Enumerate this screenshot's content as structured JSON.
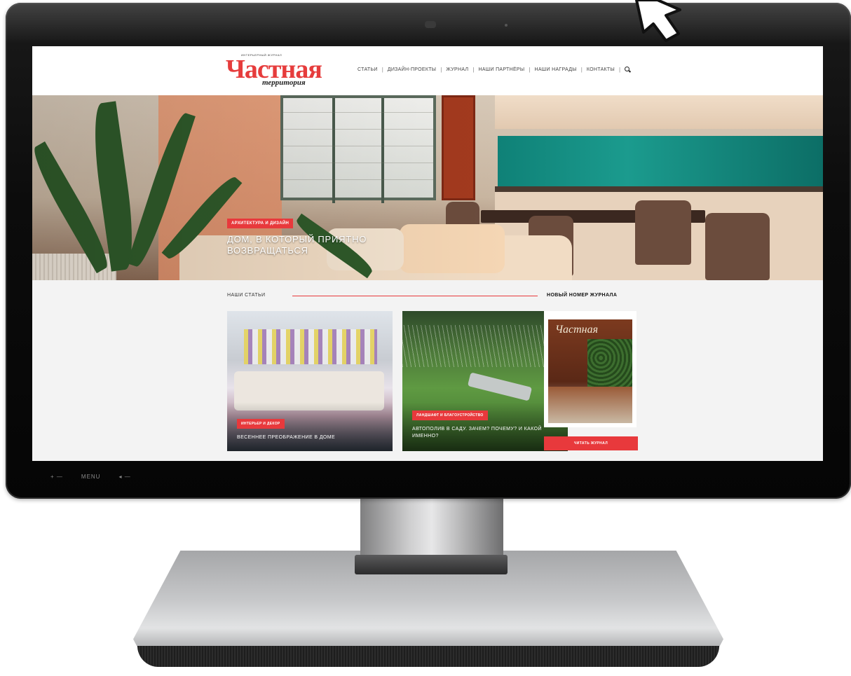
{
  "site": {
    "logo_tagline": "ИНТЕРЬЕРНЫЙ ЖУРНАЛ",
    "logo_main": "Частная",
    "logo_sub": "территория"
  },
  "nav": {
    "items": [
      "СТАТЬИ",
      "ДИЗАЙН-ПРОЕКТЫ",
      "ЖУРНАЛ",
      "НАШИ ПАРТНЁРЫ",
      "НАШИ НАГРАДЫ",
      "КОНТАКТЫ"
    ]
  },
  "hero": {
    "badge": "АРХИТЕКТУРА И ДИЗАЙН",
    "title": "ДОМ, В КОТОРЫЙ ПРИЯТНО ВОЗВРАЩАТЬСЯ"
  },
  "articles": {
    "heading": "НАШИ СТАТЬИ",
    "cards": [
      {
        "badge": "ИНТЕРЬЕР И ДЕКОР",
        "title": "ВЕСЕННЕЕ ПРЕОБРАЖЕНИЕ В ДОМЕ"
      },
      {
        "badge": "ЛАНДШАФТ И БЛАГОУСТРОЙСТВО",
        "title": "АВТОПОЛИВ В САДУ. ЗАЧЕМ? ПОЧЕМУ? И КАКОЙ ИМЕННО?"
      }
    ]
  },
  "magazine": {
    "heading": "НОВЫЙ НОМЕР ЖУРНАЛА",
    "cover_title": "Частная",
    "button": "ЧИТАТЬ ЖУРНАЛ"
  },
  "bezel": {
    "controls": [
      "+ —",
      "MENU",
      "◂ —"
    ]
  }
}
